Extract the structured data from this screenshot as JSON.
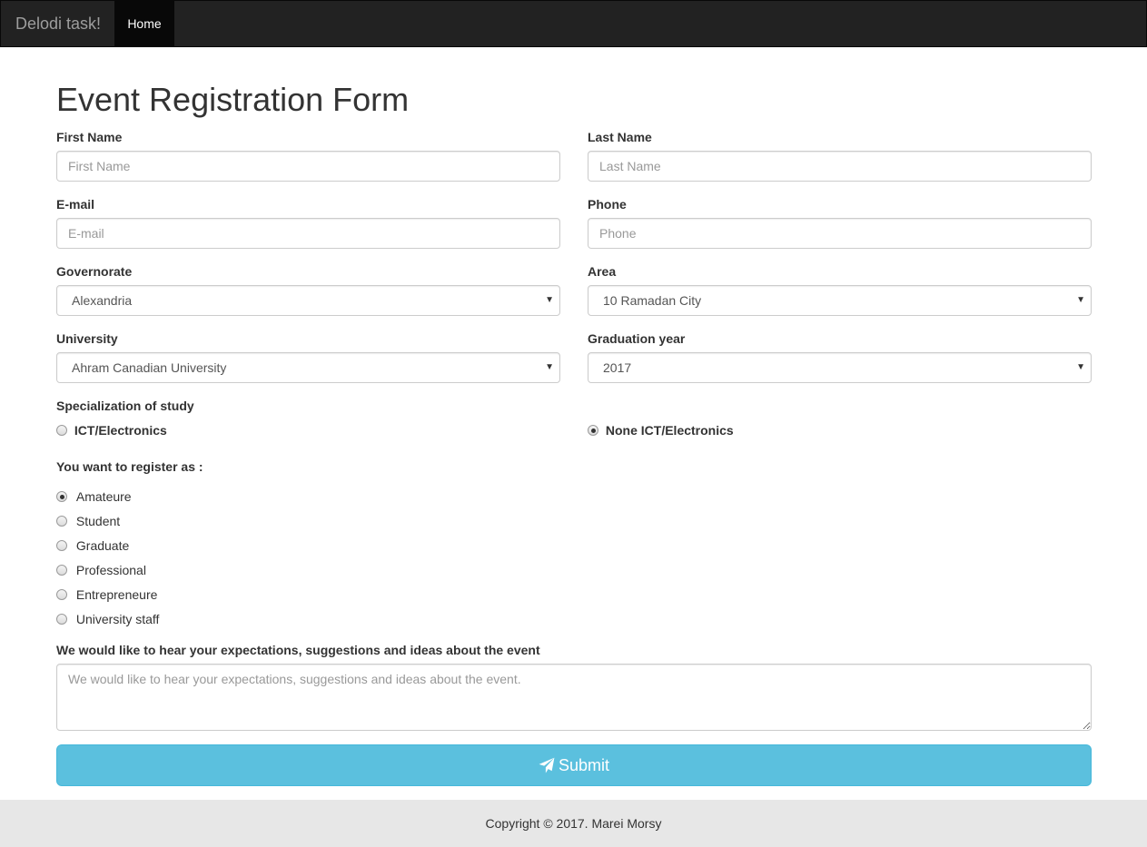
{
  "navbar": {
    "brand": "Delodi task!",
    "home": "Home"
  },
  "page": {
    "title": "Event Registration Form"
  },
  "fields": {
    "first_name": {
      "label": "First Name",
      "placeholder": "First Name"
    },
    "last_name": {
      "label": "Last Name",
      "placeholder": "Last Name"
    },
    "email": {
      "label": "E-mail",
      "placeholder": "E-mail"
    },
    "phone": {
      "label": "Phone",
      "placeholder": "Phone"
    },
    "governorate": {
      "label": "Governorate",
      "value": "Alexandria"
    },
    "area": {
      "label": "Area",
      "value": "10 Ramadan City"
    },
    "university": {
      "label": "University",
      "value": "Ahram Canadian University"
    },
    "graduation_year": {
      "label": "Graduation year",
      "value": "2017"
    }
  },
  "specialization": {
    "label": "Specialization of study",
    "options": [
      {
        "label": "ICT/Electronics",
        "checked": false
      },
      {
        "label": "None ICT/Electronics",
        "checked": true
      }
    ]
  },
  "register_as": {
    "label": "You want to register as :",
    "options": [
      {
        "label": "Amateure",
        "checked": true
      },
      {
        "label": "Student",
        "checked": false
      },
      {
        "label": "Graduate",
        "checked": false
      },
      {
        "label": "Professional",
        "checked": false
      },
      {
        "label": "Entrepreneure",
        "checked": false
      },
      {
        "label": "University staff",
        "checked": false
      }
    ]
  },
  "expectations": {
    "label": "We would like to hear your expectations, suggestions and ideas about the event",
    "placeholder": "We would like to hear your expectations, suggestions and ideas about the event."
  },
  "submit": {
    "label": "Submit",
    "icon": "paper-plane-icon",
    "color": "#5bc0de"
  },
  "footer": {
    "text": "Copyright © 2017. Marei Morsy"
  }
}
